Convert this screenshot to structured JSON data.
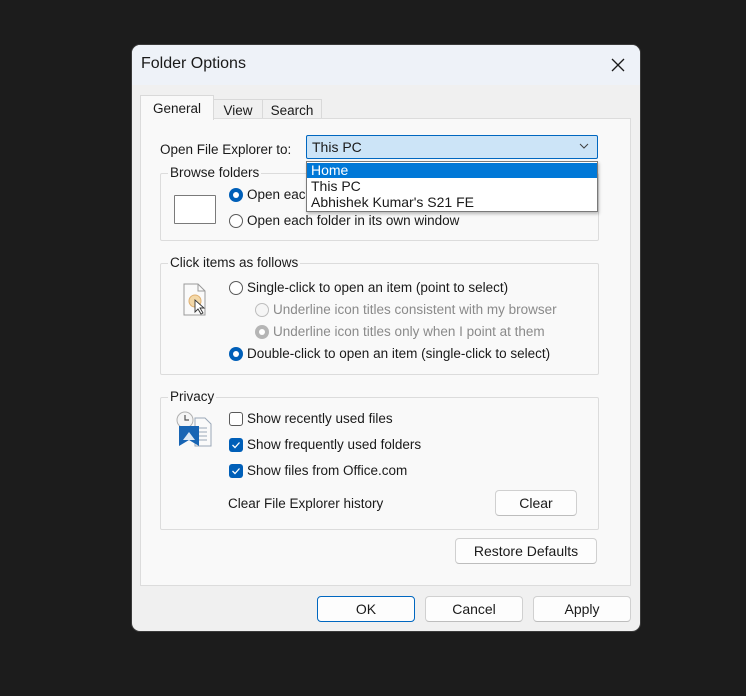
{
  "window": {
    "title": "Folder Options",
    "close_icon": "close-icon"
  },
  "tabs": [
    {
      "label": "General",
      "active": true
    },
    {
      "label": "View",
      "active": false
    },
    {
      "label": "Search",
      "active": false
    }
  ],
  "open_explorer": {
    "label": "Open File Explorer to:",
    "value": "This PC",
    "options": [
      "Home",
      "This PC",
      "Abhishek Kumar's S21 FE"
    ],
    "highlighted": "Home"
  },
  "browse_folders": {
    "title": "Browse folders",
    "options": [
      {
        "label": "Open each folder in the same window",
        "visible_label": "Open eac",
        "selected": true
      },
      {
        "label": "Open each folder in its own window",
        "selected": false
      }
    ]
  },
  "click_items": {
    "title": "Click items as follows",
    "options": [
      {
        "label": "Single-click to open an item (point to select)",
        "selected": false,
        "enabled": true
      },
      {
        "label": "Underline icon titles consistent with my browser",
        "selected": false,
        "enabled": false
      },
      {
        "label": "Underline icon titles only when I point at them",
        "selected": true,
        "enabled": false
      },
      {
        "label": "Double-click to open an item (single-click to select)",
        "selected": true,
        "enabled": true
      }
    ]
  },
  "privacy": {
    "title": "Privacy",
    "checkboxes": [
      {
        "label": "Show recently used files",
        "checked": false
      },
      {
        "label": "Show frequently used folders",
        "checked": true
      },
      {
        "label": "Show files from Office.com",
        "checked": true
      }
    ],
    "clear_label": "Clear File Explorer history",
    "clear_button": "Clear"
  },
  "restore_defaults": "Restore Defaults",
  "footer": {
    "ok": "OK",
    "cancel": "Cancel",
    "apply": "Apply"
  },
  "colors": {
    "accent": "#005fb8",
    "highlight": "#0078d7",
    "combo_bg": "#cce4f7"
  }
}
